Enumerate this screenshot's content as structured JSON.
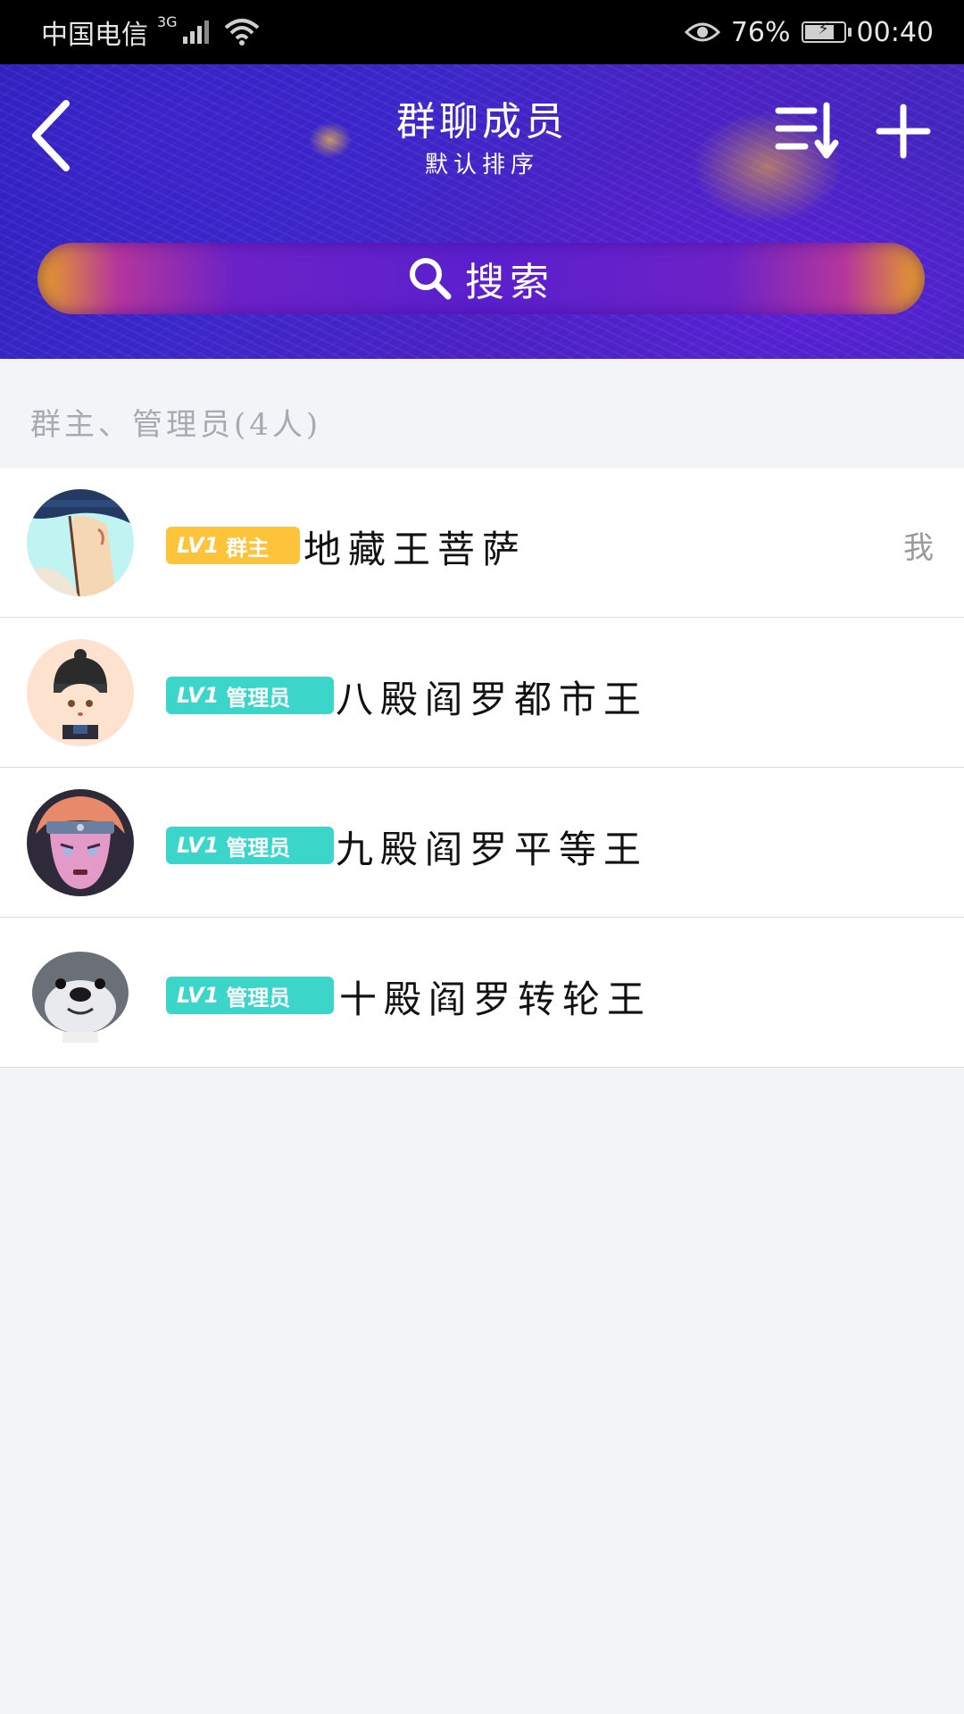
{
  "status_bar": {
    "carrier": "中国电信",
    "network": "3G",
    "battery": "76%",
    "battery_level": 0.76,
    "time": "00:40",
    "icons": [
      "signal-icon",
      "wifi-icon",
      "eye-icon",
      "battery-icon"
    ]
  },
  "header": {
    "title": "群聊成员",
    "subtitle": "默认排序",
    "search_label": "搜索",
    "icons": [
      "back-arrow-icon",
      "sort-icon",
      "plus-icon",
      "search-icon"
    ]
  },
  "section": {
    "title": "群主、管理员(4人)"
  },
  "members": [
    {
      "level": "LV1",
      "role": "群主",
      "role_color": "#fdc33a",
      "name": "地藏王菩萨",
      "me": "我"
    },
    {
      "level": "LV1",
      "role": "管理员",
      "role_color": "#3bd5c9",
      "name": "八殿阎罗都市王",
      "me": ""
    },
    {
      "level": "LV1",
      "role": "管理员",
      "role_color": "#3bd5c9",
      "name": "九殿阎罗平等王",
      "me": ""
    },
    {
      "level": "LV1",
      "role": "管理员",
      "role_color": "#3bd5c9",
      "name": "十殿阎罗转轮王",
      "me": ""
    }
  ]
}
